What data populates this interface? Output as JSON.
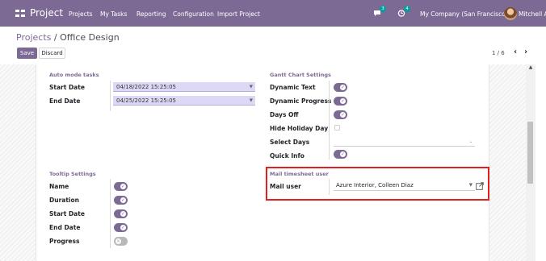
{
  "navbar": {
    "brand": "Project",
    "menu": [
      "Projects",
      "My Tasks",
      "Reporting",
      "Configuration",
      "Import Project"
    ],
    "chat_count": "3",
    "activity_count": "4",
    "company": "My Company (San Francisco)",
    "user": "Mitchell Admin",
    "bg_color": "#7c6a95"
  },
  "breadcrumb": {
    "parent": "Projects",
    "separator": " / ",
    "current": "Office Design"
  },
  "buttons": {
    "save": "Save",
    "discard": "Discard"
  },
  "pager": {
    "value": "1 / 6",
    "prev": "‹",
    "next": "›"
  },
  "auto_mode": {
    "title": "Auto mode tasks",
    "start_label": "Start Date",
    "start_value": "04/18/2022 15:25:05",
    "end_label": "End Date",
    "end_value": "04/25/2022 15:25:05"
  },
  "gantt": {
    "title": "Gantt Chart Settings",
    "fields": [
      {
        "label": "Dynamic Text",
        "state": "on"
      },
      {
        "label": "Dynamic Progress",
        "state": "on"
      },
      {
        "label": "Days Off",
        "state": "on"
      },
      {
        "label": "Hide Holiday Day",
        "state": "unchecked"
      },
      {
        "label": "Select Days",
        "state": "select"
      },
      {
        "label": "Quick Info",
        "state": "on"
      }
    ]
  },
  "tooltip": {
    "title": "Tooltip Settings",
    "fields": [
      {
        "label": "Name",
        "state": "on"
      },
      {
        "label": "Duration",
        "state": "on"
      },
      {
        "label": "Start Date",
        "state": "on"
      },
      {
        "label": "End Date",
        "state": "on"
      },
      {
        "label": "Progress",
        "state": "off"
      }
    ]
  },
  "mail": {
    "title": "Mail timesheet user",
    "label": "Mail user",
    "value": "Azure Interior, Colleen Diaz"
  },
  "icons": {
    "apps": "apps-grid-icon",
    "chat": "chat-bubble-icon",
    "activity": "clock-icon",
    "external": "external-link-icon",
    "caret": "caret-down-icon"
  },
  "colors": {
    "accent": "#7c6a95",
    "highlight": "#e02020",
    "date_bg": "#dcd8f5"
  }
}
